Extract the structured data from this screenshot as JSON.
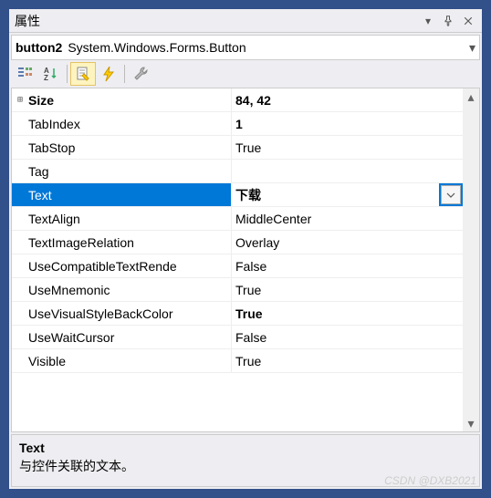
{
  "titlebar": {
    "title": "属性"
  },
  "obj": {
    "name": "button2",
    "type": "System.Windows.Forms.Button"
  },
  "props": [
    {
      "name": "Size",
      "value": "84, 42",
      "boldName": true,
      "boldVal": true,
      "expand": true
    },
    {
      "name": "TabIndex",
      "value": "1",
      "boldVal": true
    },
    {
      "name": "TabStop",
      "value": "True"
    },
    {
      "name": "Tag",
      "value": ""
    },
    {
      "name": "Text",
      "value": "下载",
      "boldVal": true,
      "selected": true,
      "dropdown": true
    },
    {
      "name": "TextAlign",
      "value": "MiddleCenter"
    },
    {
      "name": "TextImageRelation",
      "value": "Overlay"
    },
    {
      "name": "UseCompatibleTextRendering",
      "displayName": "UseCompatibleTextRende",
      "value": "False"
    },
    {
      "name": "UseMnemonic",
      "value": "True"
    },
    {
      "name": "UseVisualStyleBackColor",
      "value": "True",
      "boldVal": true
    },
    {
      "name": "UseWaitCursor",
      "value": "False"
    },
    {
      "name": "Visible",
      "value": "True"
    }
  ],
  "desc": {
    "name": "Text",
    "text": "与控件关联的文本。"
  },
  "watermark": "CSDN @DXB2021"
}
